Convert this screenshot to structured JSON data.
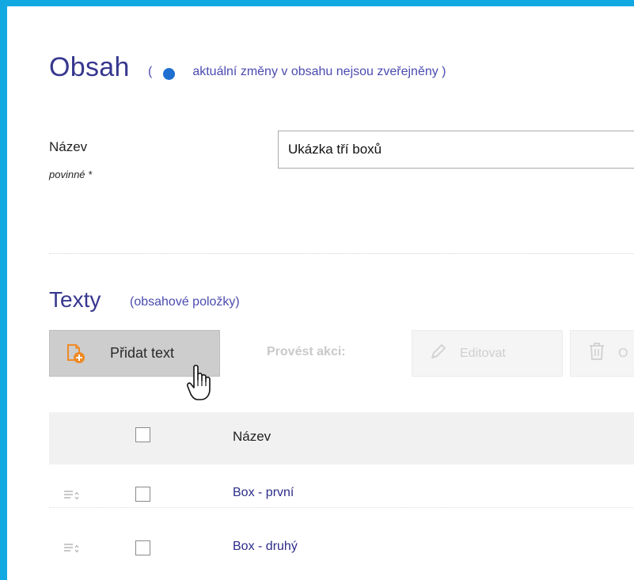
{
  "content": {
    "title": "Obsah",
    "note_open": "(",
    "note_text": "aktuální změny v obsahu nejsou zveřejněny )",
    "status_color": "#1e6fd0"
  },
  "form": {
    "name_label": "Název",
    "required_label": "povinné *",
    "name_value": "Ukázka tří boxů"
  },
  "texts": {
    "title": "Texty",
    "subtitle": "(obsahové položky)",
    "add_button": "Přidat text",
    "action_label": "Provést akci:",
    "edit_button": "Editovat",
    "delete_button": "O",
    "column_name": "Název",
    "rows": [
      {
        "name": "Box - první"
      },
      {
        "name": "Box - druhý"
      }
    ]
  },
  "colors": {
    "frame": "#12a9e3",
    "heading": "#37378f",
    "link": "#2c2c8a"
  }
}
